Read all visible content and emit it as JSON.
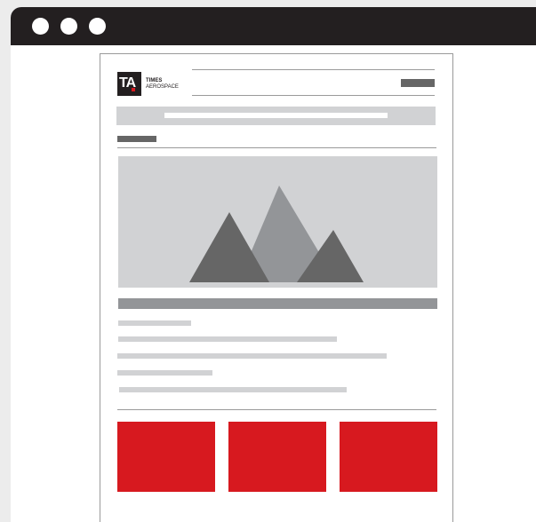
{
  "window": {
    "controls": [
      "window-dot-1",
      "window-dot-2",
      "window-dot-3"
    ]
  },
  "brand": {
    "logo_text": "TA",
    "name_line1": "TIMES",
    "name_line2": "AEROSPACE"
  },
  "hero": {
    "image": "mountain-placeholder-icon"
  },
  "colors": {
    "titlebar": "#231f20",
    "placeholder_light": "#d1d2d4",
    "placeholder_mid": "#939598",
    "placeholder_dark": "#666666",
    "accent_red": "#d7191f"
  },
  "cards": [
    "card-1",
    "card-2",
    "card-3"
  ]
}
